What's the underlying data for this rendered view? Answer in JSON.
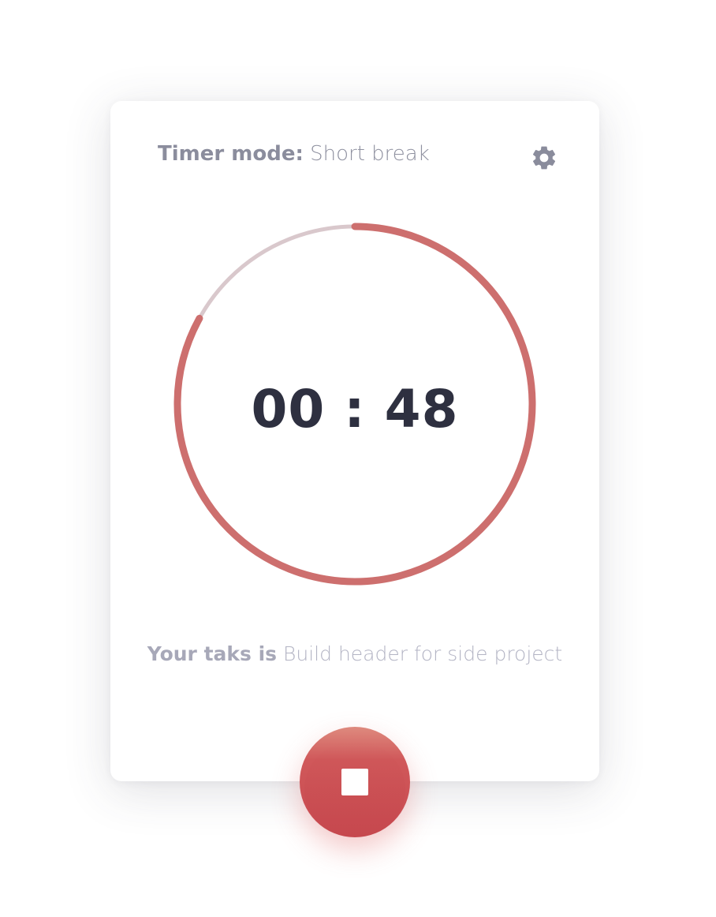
{
  "header": {
    "mode_label": "Timer mode:",
    "mode_value": "Short break",
    "settings_icon": "gear-icon"
  },
  "timer": {
    "display": "00 : 48",
    "progress_fraction": 0.83,
    "colors": {
      "progress": "#cd6f6e",
      "track": "#d9c8cc"
    }
  },
  "task": {
    "label": "Your taks is",
    "value": "Build header for side project"
  },
  "controls": {
    "stop_icon": "stop-icon",
    "button_color": "#cf5658"
  }
}
